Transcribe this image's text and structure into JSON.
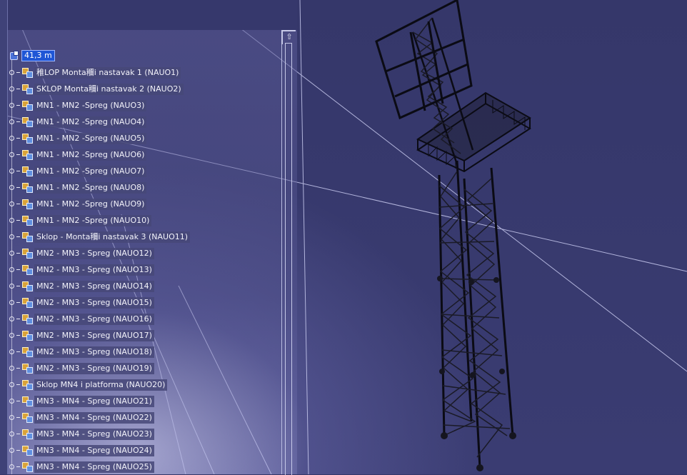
{
  "tree": {
    "root_label": "41,3 m",
    "items": [
      {
        "label": "稚LOP Monta鿠i nastavak 1 (NAUO1)"
      },
      {
        "label": "SKLOP Monta鿠i nastavak 2 (NAUO2)"
      },
      {
        "label": "MN1 - MN2 -Spreg (NAUO3)"
      },
      {
        "label": "MN1 - MN2 -Spreg (NAUO4)"
      },
      {
        "label": "MN1 - MN2 -Spreg (NAUO5)"
      },
      {
        "label": "MN1 - MN2 -Spreg (NAUO6)"
      },
      {
        "label": "MN1 - MN2 -Spreg (NAUO7)"
      },
      {
        "label": "MN1 - MN2 -Spreg (NAUO8)"
      },
      {
        "label": "MN1 - MN2 -Spreg (NAUO9)"
      },
      {
        "label": "MN1 - MN2 -Spreg (NAUO10)"
      },
      {
        "label": "Sklop - Monta鿠i nastavak 3 (NAUO11)"
      },
      {
        "label": "MN2 - MN3 - Spreg (NAUO12)"
      },
      {
        "label": "MN2 - MN3 - Spreg (NAUO13)"
      },
      {
        "label": "MN2 - MN3 - Spreg (NAUO14)"
      },
      {
        "label": "MN2 - MN3 - Spreg (NAUO15)"
      },
      {
        "label": "MN2 - MN3 - Spreg (NAUO16)"
      },
      {
        "label": "MN2 - MN3 - Spreg (NAUO17)"
      },
      {
        "label": "MN2 - MN3 - Spreg (NAUO18)"
      },
      {
        "label": "MN2 - MN3 - Spreg (NAUO19)"
      },
      {
        "label": "Sklop MN4 i platforma (NAUO20)"
      },
      {
        "label": "MN3 - MN4 - Spreg (NAUO21)"
      },
      {
        "label": "MN3 - MN4 - Spreg (NAUO22)"
      },
      {
        "label": "MN3 - MN4 - Spreg (NAUO23)"
      },
      {
        "label": "MN3 - MN4 - Spreg (NAUO24)"
      },
      {
        "label": "MN3 - MN4 - Spreg (NAUO25)"
      }
    ]
  },
  "scrollbar": {
    "up_arrow": "⇧"
  },
  "colors": {
    "background": "#35376a",
    "tree_label_bg": "#464878",
    "selection": "#1f56d6",
    "model": "#0a0a12"
  },
  "icons": {
    "root": "product-root-icon",
    "node": "assembly-node-icon"
  }
}
